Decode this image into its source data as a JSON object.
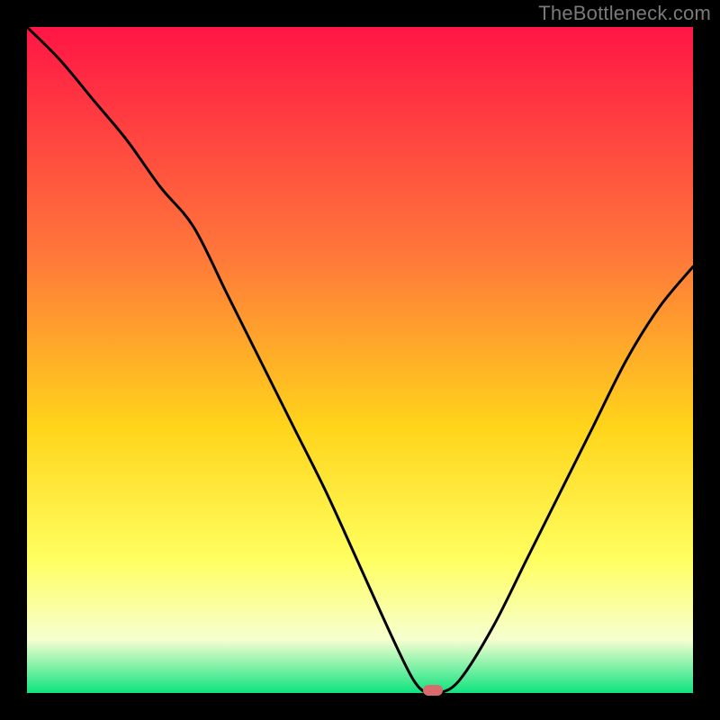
{
  "watermark": "TheBottleneck.com",
  "colors": {
    "frame": "#000000",
    "watermark": "#7a7a7a",
    "curve": "#000000",
    "marker": "#d96b6e",
    "grad_top": "#ff1545",
    "grad_mid1": "#ff7a3a",
    "grad_mid2": "#ffd41a",
    "grad_mid3": "#ffff60",
    "grad_mid4": "#f6ffd0",
    "grad_bottom": "#0fe37f"
  },
  "chart_data": {
    "type": "line",
    "title": "",
    "xlabel": "",
    "ylabel": "",
    "xlim": [
      0,
      1
    ],
    "ylim": [
      0,
      1
    ],
    "grid": false,
    "legend": false,
    "x": [
      0.0,
      0.05,
      0.1,
      0.15,
      0.2,
      0.25,
      0.3,
      0.35,
      0.4,
      0.45,
      0.5,
      0.55,
      0.58,
      0.6,
      0.62,
      0.65,
      0.7,
      0.75,
      0.8,
      0.85,
      0.9,
      0.95,
      1.0
    ],
    "y": [
      1.0,
      0.95,
      0.89,
      0.83,
      0.76,
      0.7,
      0.6,
      0.5,
      0.4,
      0.3,
      0.19,
      0.08,
      0.02,
      0.0,
      0.0,
      0.02,
      0.1,
      0.2,
      0.3,
      0.4,
      0.5,
      0.58,
      0.64
    ],
    "min_point": {
      "x": 0.61,
      "y": 0.0
    },
    "marker": {
      "x": 0.61,
      "y": 0.0
    }
  },
  "geometry": {
    "frame_size": 800,
    "plot_inset": 30,
    "plot_size": 740
  }
}
